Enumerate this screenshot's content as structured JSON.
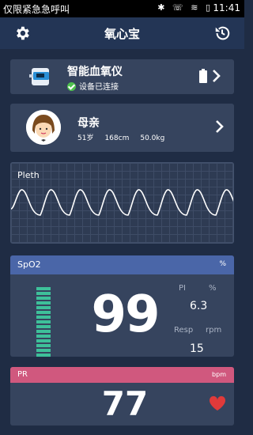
{
  "statusbar": {
    "carrier": "仅限紧急急呼叫",
    "icons": "✱ ☏ ≋ ▯",
    "time": "11:41"
  },
  "header": {
    "title": "氧心宝",
    "settings_icon": "gear-icon",
    "history_icon": "history-icon"
  },
  "device": {
    "name": "智能血氧仪",
    "status": "设备已连接"
  },
  "user": {
    "name": "母亲",
    "age": "51岁",
    "height": "168cm",
    "weight": "50.0kg"
  },
  "pleth": {
    "label": "Pleth"
  },
  "spo2": {
    "label": "SpO2",
    "unit": "%",
    "value": "99",
    "pi_label": "PI",
    "pi_unit": "%",
    "pi_value": "6.3",
    "resp_label": "Resp",
    "resp_unit": "rpm",
    "resp_value": "15",
    "bar_segments": 15,
    "colors": {
      "header": "#4a66a8",
      "bar": "#3ec09a"
    }
  },
  "pr": {
    "label": "PR",
    "unit": "bpm",
    "value": "77",
    "colors": {
      "header": "#d0587e",
      "heart": "#e03a3a"
    }
  },
  "colors": {
    "background": "#1f2c44",
    "card": "#36445e",
    "header": "#233555"
  }
}
